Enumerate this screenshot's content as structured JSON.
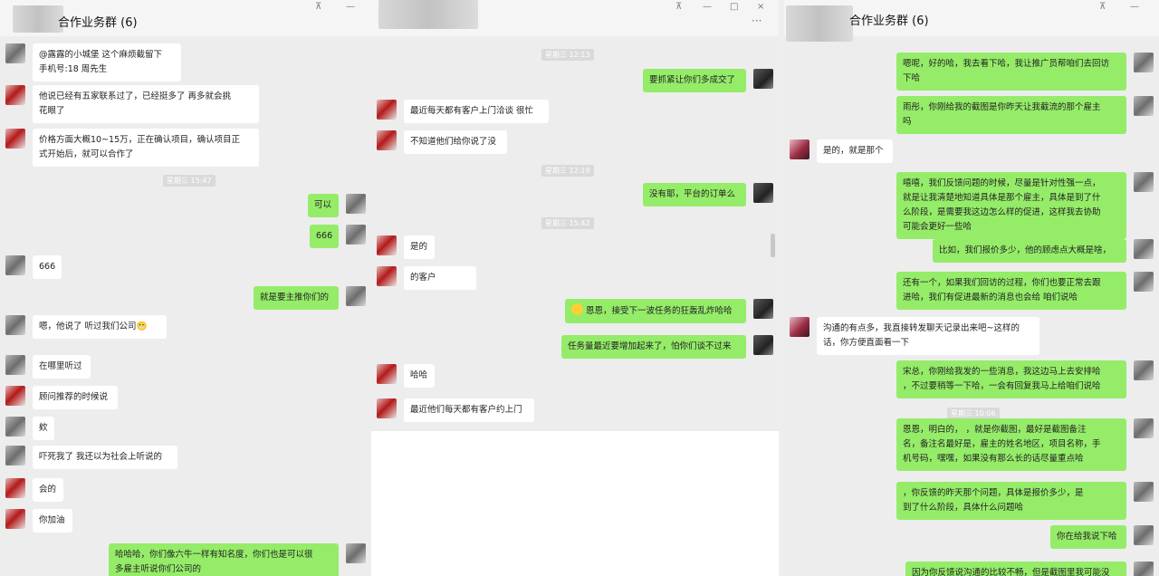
{
  "window_left": {
    "title": "合作业务群 (6)",
    "controls": [
      "⊼",
      "—"
    ],
    "messages": [
      {
        "dir": "in",
        "avatar": "photo",
        "text": "@露露的小城堡  这个麻烦截留下\n手机号:18              周先生"
      },
      {
        "dir": "in",
        "avatar": "red",
        "text": "他说已经有五家联系过了，已经挺多了  再多就会挑\n花眼了"
      },
      {
        "dir": "in",
        "avatar": "red",
        "text": "价格方面大概10~15万，正在确认项目，确认项目正\n式开始后，就可以合作了"
      },
      {
        "dir": "out",
        "avatar": "photo",
        "text": "可以"
      },
      {
        "dir": "out",
        "avatar": "photo",
        "text": "666"
      },
      {
        "dir": "in",
        "avatar": "photo",
        "text": "666"
      },
      {
        "dir": "out",
        "avatar": "photo",
        "text": "就是要主推你们的"
      },
      {
        "dir": "in",
        "avatar": "photo",
        "text": "嗯，他说了   听过我们公司😬"
      },
      {
        "dir": "in",
        "avatar": "photo",
        "text": "在哪里听过"
      },
      {
        "dir": "in",
        "avatar": "red",
        "text": "顾问推荐的时候说"
      },
      {
        "dir": "in",
        "avatar": "photo",
        "text": "欸"
      },
      {
        "dir": "in",
        "avatar": "photo",
        "text": "吓死我了 我还以为社会上听说的"
      },
      {
        "dir": "in",
        "avatar": "red",
        "text": "会的"
      },
      {
        "dir": "in",
        "avatar": "red",
        "text": "你加油"
      },
      {
        "dir": "out",
        "avatar": "photo",
        "text": "哈哈哈，你们像六牛一样有知名度，你们也是可以很\n多雇主听说你们公司的"
      }
    ],
    "stamps": [
      "星期三 15:47"
    ]
  },
  "window_middle": {
    "title": "",
    "controls": [
      "⊼",
      "—",
      "□",
      "×",
      "···"
    ],
    "messages": [
      {
        "dir": "out",
        "avatar": "dark",
        "text": "要抓紧让你们多成交了"
      },
      {
        "dir": "in",
        "avatar": "red",
        "text": "最近每天都有客户上门洽谈 很忙"
      },
      {
        "dir": "in",
        "avatar": "red",
        "text": "不知道他们给你说了没"
      },
      {
        "dir": "out",
        "avatar": "dark",
        "text": "没有耶，平台的订单么"
      },
      {
        "dir": "in",
        "avatar": "red",
        "text": "是的"
      },
      {
        "dir": "in",
        "avatar": "red",
        "text": "      的客户"
      },
      {
        "dir": "out",
        "avatar": "dark",
        "text": "恩恩，接受下一波任务的狂轰乱炸哈哈",
        "emoji": "🙂"
      },
      {
        "dir": "out",
        "avatar": "dark",
        "text": "任务量最近要增加起来了，怕你们谈不过来"
      },
      {
        "dir": "in",
        "avatar": "red",
        "text": "哈哈"
      },
      {
        "dir": "in",
        "avatar": "red",
        "text": "最近他们每天都有客户约上门"
      }
    ],
    "stamps": [
      "星期三 12:13",
      "星期三 12:19",
      "星期三 15:42"
    ]
  },
  "window_right": {
    "title": "合作业务群 (6)",
    "controls": [
      "⊼",
      "—"
    ],
    "messages": [
      {
        "dir": "out",
        "avatar": "photo",
        "text": "嗯呢，好的哈，我去看下哈，我让推广员帮咱们去回访\n下哈"
      },
      {
        "dir": "out",
        "avatar": "photo",
        "text": "雨彤，你刚给我的截图是你昨天让我截流的那个雇主\n吗"
      },
      {
        "dir": "in",
        "avatar": "pink",
        "text": "是的，就是那个"
      },
      {
        "dir": "out",
        "avatar": "photo",
        "text": "嘻嘻，我们反馈问题的时候，尽量是针对性强一点，\n就是让我清楚地知道具体是那个雇主，具体是到了什\n么阶段，是需要我这边怎么样的促进，这样我去协助\n可能会更好一些哈"
      },
      {
        "dir": "out",
        "avatar": "photo",
        "text": "比如，我们报价多少，他的顾虑点大概是啥，"
      },
      {
        "dir": "out",
        "avatar": "photo",
        "text": "还有一个，如果我们回访的过程，你们也要正常去跟\n进哈，我们有促进最新的消息也会给 咱们说哈"
      },
      {
        "dir": "in",
        "avatar": "pink",
        "text": "沟通的有点多，我直接转发聊天记录出来吧~这样的\n话，你方便直面看一下"
      },
      {
        "dir": "out",
        "avatar": "photo",
        "text": "宋总，你刚给我发的一些消息，我这边马上去安排哈\n，不过要稍等一下哈，一会有回复我马上给咱们说哈"
      },
      {
        "dir": "out",
        "avatar": "photo",
        "text": "恩恩，明白的，    ，就是你截图，最好是截图备注\n名，备注名最好是，雇主的姓名地区，项目名称，手\n机号码，嘿嘿，如果没有那么长的话尽量重点哈"
      },
      {
        "dir": "out",
        "avatar": "photo",
        "text": "    ，你反馈的昨天那个问题，具体是报价多少，是\n到了什么阶段，具体什么问题哈"
      },
      {
        "dir": "out",
        "avatar": "photo",
        "text": "你在给我说下哈"
      },
      {
        "dir": "out",
        "avatar": "photo",
        "text": "因为你反馈说沟通的比较不畅，但是截图里我可能没"
      }
    ],
    "stamps": [
      "星期三 10:06"
    ]
  }
}
